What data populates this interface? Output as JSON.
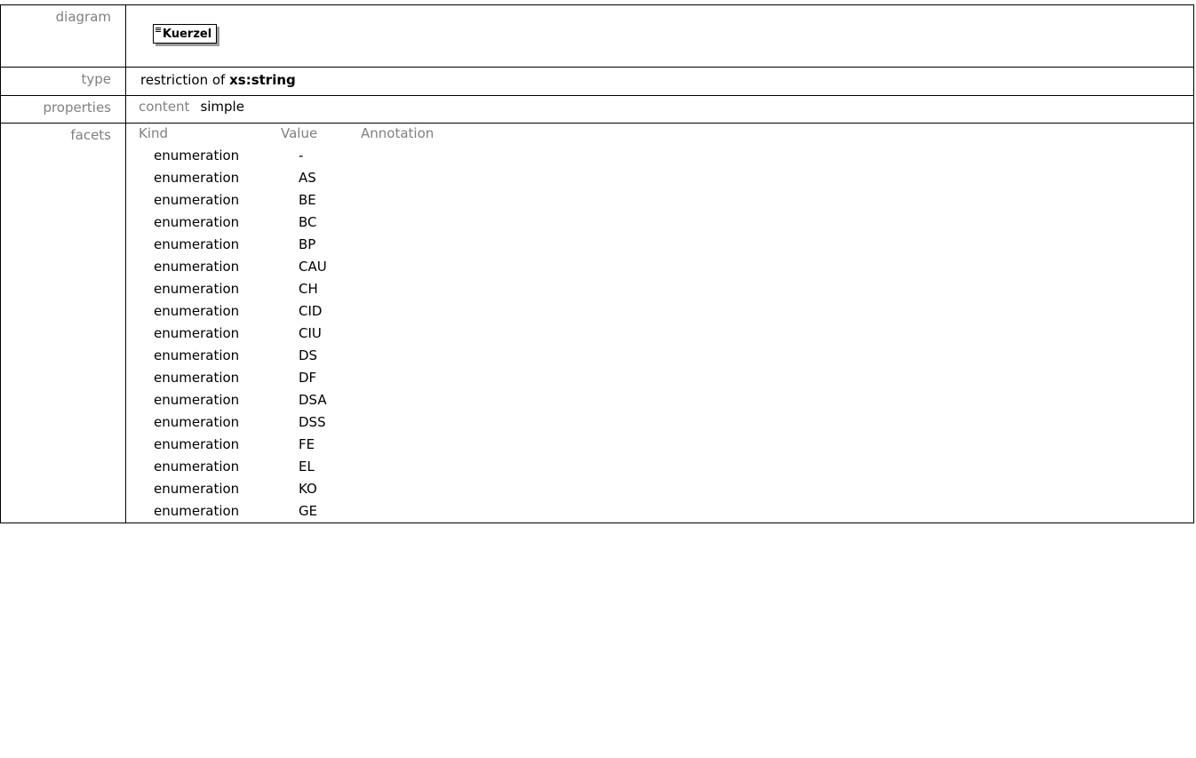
{
  "labels": {
    "diagram": "diagram",
    "type": "type",
    "properties": "properties",
    "facets": "facets"
  },
  "diagram": {
    "box_label": "Kuerzel",
    "icon": "element-lines-icon"
  },
  "type": {
    "prefix": "restriction of",
    "base": "xs:string"
  },
  "properties": {
    "key": "content",
    "value": "simple"
  },
  "facets": {
    "headers": [
      "Kind",
      "Value",
      "Annotation"
    ],
    "rows": [
      {
        "kind": "enumeration",
        "value": "-"
      },
      {
        "kind": "enumeration",
        "value": "AS"
      },
      {
        "kind": "enumeration",
        "value": "BE"
      },
      {
        "kind": "enumeration",
        "value": "BC"
      },
      {
        "kind": "enumeration",
        "value": "BP"
      },
      {
        "kind": "enumeration",
        "value": "CAU"
      },
      {
        "kind": "enumeration",
        "value": "CH"
      },
      {
        "kind": "enumeration",
        "value": "CID"
      },
      {
        "kind": "enumeration",
        "value": "CIU"
      },
      {
        "kind": "enumeration",
        "value": "DS"
      },
      {
        "kind": "enumeration",
        "value": "DF"
      },
      {
        "kind": "enumeration",
        "value": "DSA"
      },
      {
        "kind": "enumeration",
        "value": "DSS"
      },
      {
        "kind": "enumeration",
        "value": "FE"
      },
      {
        "kind": "enumeration",
        "value": "EL"
      },
      {
        "kind": "enumeration",
        "value": "KO"
      },
      {
        "kind": "enumeration",
        "value": "GE"
      }
    ]
  }
}
